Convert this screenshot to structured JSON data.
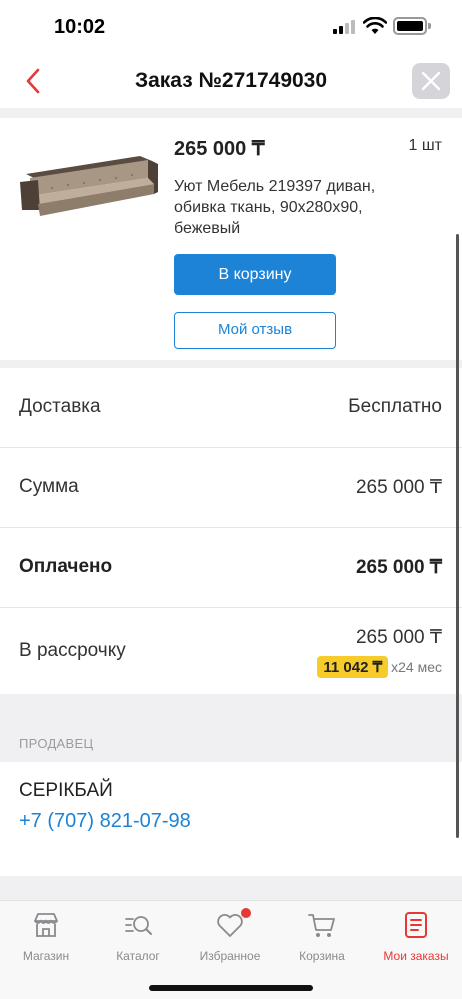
{
  "status_bar": {
    "time": "10:02"
  },
  "header": {
    "title": "Заказ №271749030"
  },
  "product": {
    "price": "265 000 ₸",
    "quantity": "1 шт",
    "name": "Уют Мебель 219397 диван, обивка ткань, 90x280x90, бежевый",
    "cart_button": "В корзину",
    "review_button": "Мой отзыв"
  },
  "summary": {
    "delivery_label": "Доставка",
    "delivery_value": "Бесплатно",
    "sum_label": "Сумма",
    "sum_value": "265 000 ₸",
    "paid_label": "Оплачено",
    "paid_value": "265 000 ₸",
    "installment_label": "В рассрочку",
    "installment_value": "265 000 ₸",
    "installment_monthly": "11 042 ₸",
    "installment_term": "x24 мес"
  },
  "seller": {
    "section_title": "ПРОДАВЕЦ",
    "name": "СЕРІКБАЙ",
    "phone": "+7 (707) 821-07-98"
  },
  "tabbar": {
    "items": [
      {
        "label": "Магазин",
        "icon": "store-icon"
      },
      {
        "label": "Каталог",
        "icon": "catalog-search-icon"
      },
      {
        "label": "Избранное",
        "icon": "heart-icon"
      },
      {
        "label": "Корзина",
        "icon": "cart-icon"
      },
      {
        "label": "Мои заказы",
        "icon": "orders-icon",
        "active": true
      }
    ]
  },
  "colors": {
    "accent_blue": "#1c83d6",
    "accent_red": "#e53935",
    "installment_badge": "#f7cc2a"
  }
}
